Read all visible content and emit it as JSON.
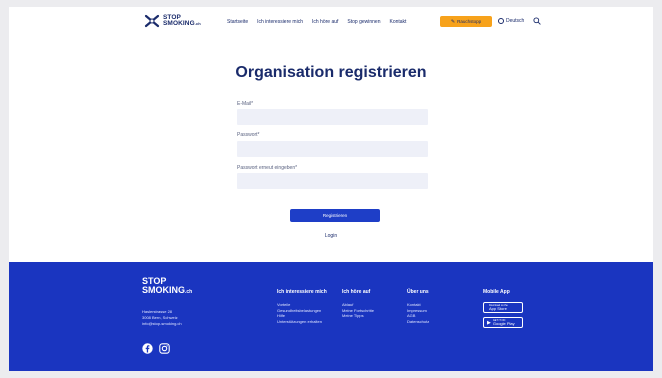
{
  "header": {
    "logo_line1": "STOP",
    "logo_line2": "SMOKING",
    "logo_suffix": ".ch",
    "nav": [
      "Startseite",
      "Ich interessiere mich",
      "Ich höre auf",
      "Stop gewinnen",
      "Kontakt"
    ],
    "cta_label": "Rauchstopp",
    "lang_label": "Deutsch"
  },
  "form": {
    "title": "Organisation registrieren",
    "email_label": "E-Mail*",
    "email_value": "",
    "password_label": "Passwort*",
    "password_value": "",
    "password_repeat_label": "Passwort erneut eingeben*",
    "password_repeat_value": "",
    "submit_label": "Registrieren",
    "login_label": "Login"
  },
  "footer": {
    "logo_line1": "STOP",
    "logo_line2": "SMOKING",
    "logo_suffix": ".ch",
    "address": [
      "Haslerstrasse 28",
      "3008 Bern, Schweiz",
      "info@stop-smoking.ch"
    ],
    "columns": [
      {
        "title": "Ich interessiere mich",
        "links": [
          "Vorteile",
          "Gesundheitsbelastungen",
          "Hilfe",
          "Unterstützungen erhalten"
        ]
      },
      {
        "title": "Ich höre auf",
        "links": [
          "Ablauf",
          "Meine Fortschritte",
          "Meine Tipps"
        ]
      },
      {
        "title": "Über uns",
        "links": [
          "Kontakt",
          "Impressum",
          "AGB",
          "Datenschutz"
        ]
      }
    ],
    "app_title": "Mobile App",
    "app_store_small": "Download on the",
    "app_store_label": "App Store",
    "play_store_small": "GET IT ON",
    "play_store_label": "Google Play"
  },
  "colors": {
    "brand_navy": "#1a2b6b",
    "brand_blue": "#1a35c0",
    "button_blue": "#1e3ec7",
    "cta_orange": "#f7a21b",
    "input_bg": "#eef0f8"
  },
  "icons": [
    "stop-smoking-logo-icon",
    "lightbulb-icon",
    "globe-icon",
    "search-icon",
    "facebook-icon",
    "instagram-icon",
    "apple-icon",
    "google-play-icon"
  ]
}
